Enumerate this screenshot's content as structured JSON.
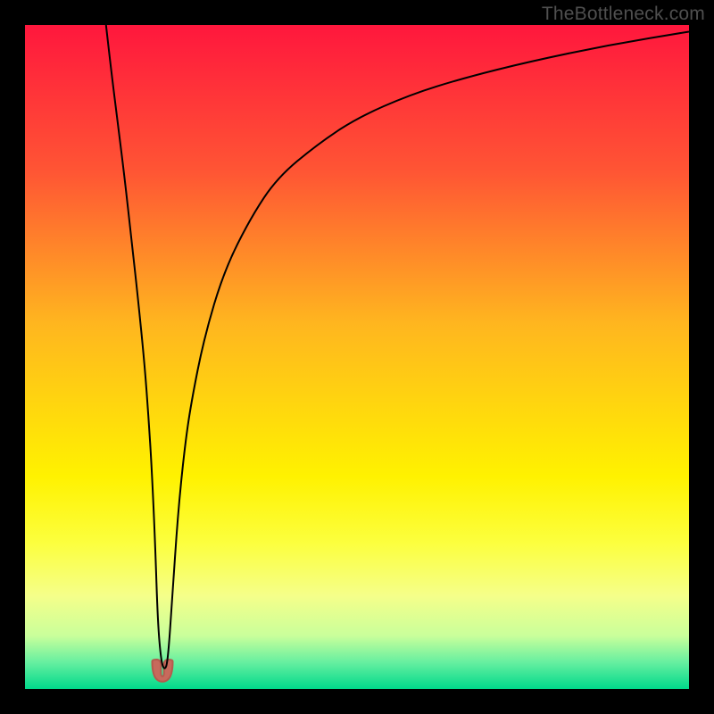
{
  "watermark": {
    "text": "TheBottleneck.com"
  },
  "chart_data": {
    "type": "line",
    "title": "",
    "xlabel": "",
    "ylabel": "",
    "xlim": [
      0,
      100
    ],
    "ylim": [
      0,
      100
    ],
    "grid": false,
    "background_gradient": {
      "stops": [
        {
          "offset": 0.0,
          "color": "#ff173d"
        },
        {
          "offset": 0.22,
          "color": "#ff5534"
        },
        {
          "offset": 0.45,
          "color": "#ffb61f"
        },
        {
          "offset": 0.68,
          "color": "#fff200"
        },
        {
          "offset": 0.78,
          "color": "#fcff3e"
        },
        {
          "offset": 0.86,
          "color": "#f5ff8a"
        },
        {
          "offset": 0.92,
          "color": "#c9ff9b"
        },
        {
          "offset": 0.96,
          "color": "#66efa0"
        },
        {
          "offset": 1.0,
          "color": "#00d98b"
        }
      ]
    },
    "series": [
      {
        "name": "curve",
        "color": "#000000",
        "width": 2,
        "x": [
          12.2,
          13,
          14,
          15,
          16,
          17,
          18,
          18.6,
          19.1,
          19.6,
          20.0,
          20.5,
          21.0,
          21.5,
          22.2,
          23,
          24,
          25,
          27,
          30,
          34,
          38,
          44,
          50,
          58,
          66,
          76,
          88,
          100
        ],
        "values": [
          100,
          93,
          85,
          77,
          68,
          59,
          49,
          41,
          33,
          22,
          10,
          4.2,
          2.8,
          4.0,
          14,
          26,
          36,
          43,
          53,
          63,
          71,
          77,
          82,
          86,
          89.5,
          92,
          94.5,
          97,
          99
        ]
      }
    ],
    "marker": {
      "name": "min-marker",
      "x": 20.7,
      "y": 2.4,
      "color": "#c76a5c",
      "stroke": "#b55a4d",
      "radius": 12
    }
  }
}
